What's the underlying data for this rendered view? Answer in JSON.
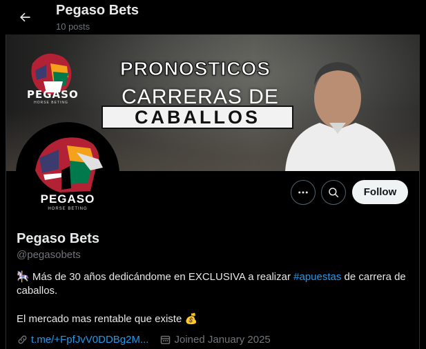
{
  "header": {
    "title": "Pegaso Bets",
    "posts": "10 posts"
  },
  "banner": {
    "logo_text": "PEGASO",
    "logo_sub": "HORSE BETING",
    "line1": "PRONOSTICOS",
    "line2": "CARRERAS DE",
    "line3": "CABALLOS"
  },
  "avatar": {
    "logo_text": "PEGASO",
    "logo_sub": "HORSE BETING"
  },
  "actions": {
    "more_icon": "more-icon",
    "search_icon": "search-icon",
    "follow_label": "Follow"
  },
  "profile": {
    "name": "Pegaso Bets",
    "handle": "@pegasobets",
    "bio_emoji": "🎠",
    "bio_before": " Más de 30 años dedicándome en EXCLUSIVA a realizar ",
    "bio_hashtag": "#apuestas",
    "bio_after": " de carrera de caballos.",
    "bio_line2": "El mercado mas rentable que existe 💰",
    "link": "t.me/+FpfJvV0DDBg2M...",
    "joined": "Joined January 2025"
  },
  "colors": {
    "accent": "#1d9bf0",
    "muted": "#71767b",
    "text": "#e7e9ea"
  }
}
